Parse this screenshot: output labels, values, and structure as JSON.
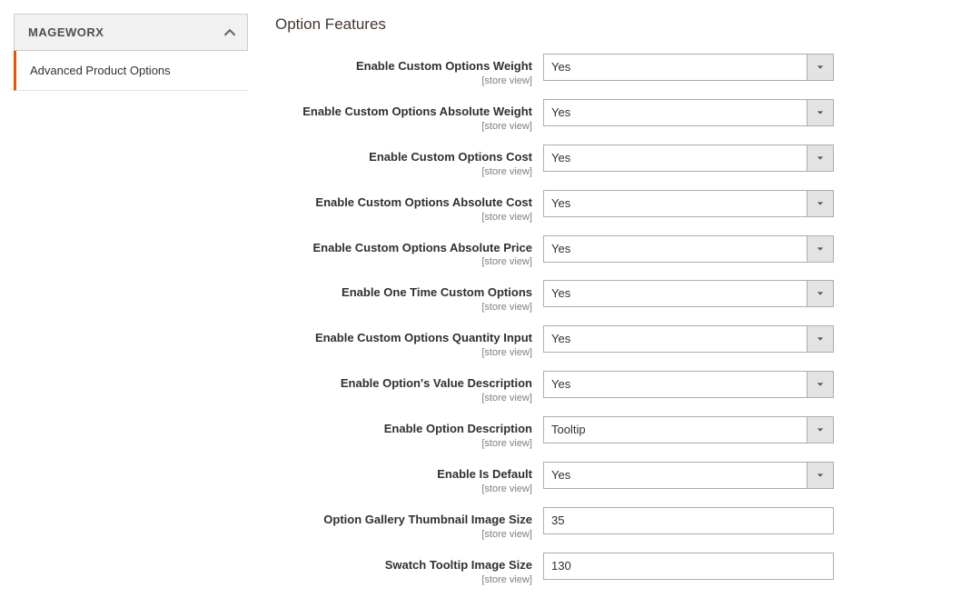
{
  "sidebar": {
    "tab_title": "MAGEWORX",
    "link_label": "Advanced Product Options"
  },
  "page_title": "Option Features",
  "scope_label": "[store view]",
  "fields": [
    {
      "label": "Enable Custom Options Weight",
      "type": "select",
      "value": "Yes"
    },
    {
      "label": "Enable Custom Options Absolute Weight",
      "type": "select",
      "value": "Yes"
    },
    {
      "label": "Enable Custom Options Cost",
      "type": "select",
      "value": "Yes"
    },
    {
      "label": "Enable Custom Options Absolute Cost",
      "type": "select",
      "value": "Yes"
    },
    {
      "label": "Enable Custom Options Absolute Price",
      "type": "select",
      "value": "Yes"
    },
    {
      "label": "Enable One Time Custom Options",
      "type": "select",
      "value": "Yes"
    },
    {
      "label": "Enable Custom Options Quantity Input",
      "type": "select",
      "value": "Yes"
    },
    {
      "label": "Enable Option's Value Description",
      "type": "select",
      "value": "Yes"
    },
    {
      "label": "Enable Option Description",
      "type": "select",
      "value": "Tooltip"
    },
    {
      "label": "Enable Is Default",
      "type": "select",
      "value": "Yes"
    },
    {
      "label": "Option Gallery Thumbnail Image Size",
      "type": "text",
      "value": "35"
    },
    {
      "label": "Swatch Tooltip Image Size",
      "type": "text",
      "value": "130"
    }
  ]
}
